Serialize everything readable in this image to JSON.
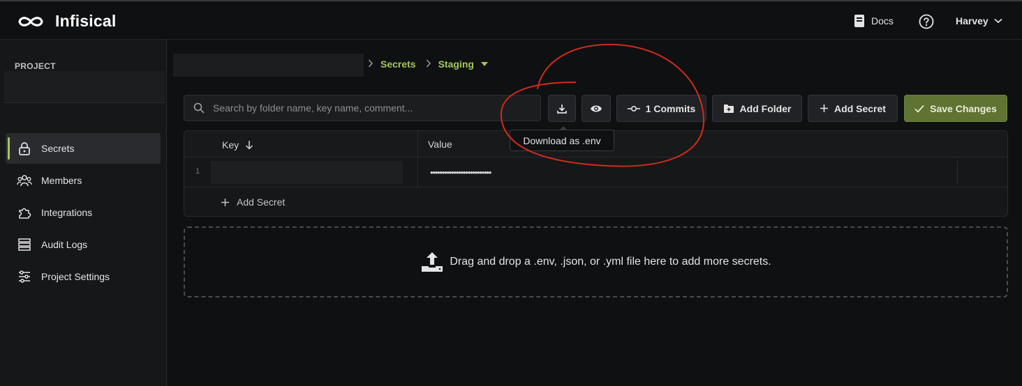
{
  "brand": {
    "name": "Infisical"
  },
  "header": {
    "docs_label": "Docs",
    "user_name": "Harvey"
  },
  "sidebar": {
    "project_label": "PROJECT",
    "items": [
      {
        "label": "Secrets",
        "icon": "lock-icon",
        "active": true
      },
      {
        "label": "Members",
        "icon": "users-icon"
      },
      {
        "label": "Integrations",
        "icon": "puzzle-icon"
      },
      {
        "label": "Audit Logs",
        "icon": "list-icon"
      },
      {
        "label": "Project Settings",
        "icon": "sliders-icon"
      }
    ]
  },
  "breadcrumb": {
    "section": "Secrets",
    "environment": "Staging"
  },
  "toolbar": {
    "search_placeholder": "Search by folder name, key name, comment...",
    "commits_label": "1 Commits",
    "add_folder_label": "Add Folder",
    "add_secret_label": "Add Secret",
    "save_label": "Save Changes",
    "download_tooltip": "Download as .env"
  },
  "table": {
    "headers": {
      "key": "Key",
      "value": "Value"
    },
    "rows": [
      {
        "num": "1",
        "value": "••••••••••••••••••••••••••"
      }
    ],
    "add_secret_label": "Add Secret"
  },
  "dropzone": {
    "text": "Drag and drop a .env, .json, or .yml file here to add more secrets."
  },
  "colors": {
    "accent": "#a3c75a",
    "save_button": "#5f7332",
    "annotation": "#d42a1a"
  }
}
